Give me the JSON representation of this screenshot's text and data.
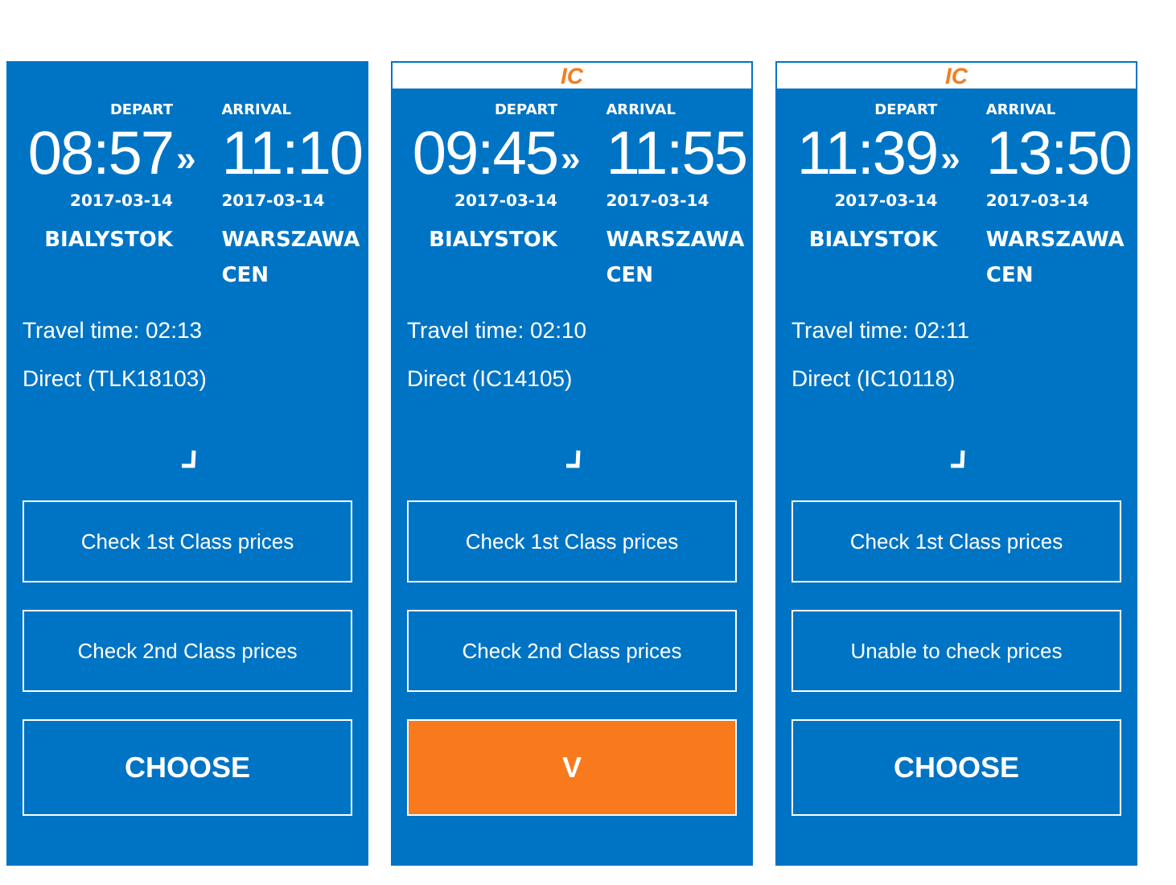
{
  "connections": [
    {
      "depart_label": "DEPART",
      "arrival_label": "ARRIVAL",
      "depart_time": "08:57",
      "separator": "»",
      "arrival_time": "11:10",
      "depart_date": "2017-03-14",
      "arrival_date": "2017-03-14",
      "from": "BIALYSTOK",
      "to": "WARSZAWA CEN",
      "travel_time": "Travel time: 02:13",
      "route": "Direct (TLK18103)",
      "buttons": [
        "Check 1st Class prices",
        "Check 2nd Class prices"
      ],
      "choose": {
        "label": "CHOOSE",
        "selected": false
      }
    },
    {
      "carrier_logo": "IC",
      "depart_label": "DEPART",
      "arrival_label": "ARRIVAL",
      "depart_time": "09:45",
      "separator": "»",
      "arrival_time": "11:55",
      "depart_date": "2017-03-14",
      "arrival_date": "2017-03-14",
      "from": "BIALYSTOK",
      "to": "WARSZAWA CEN",
      "travel_time": "Travel time: 02:10",
      "route": "Direct (IC14105)",
      "buttons": [
        "Check 1st Class prices",
        "Check 2nd Class prices"
      ],
      "choose": {
        "label": "V",
        "selected": true
      }
    },
    {
      "carrier_logo": "IC",
      "depart_label": "DEPART",
      "arrival_label": "ARRIVAL",
      "depart_time": "11:39",
      "separator": "»",
      "arrival_time": "13:50",
      "depart_date": "2017-03-14",
      "arrival_date": "2017-03-14",
      "from": "BIALYSTOK",
      "to": "WARSZAWA CEN",
      "travel_time": "Travel time: 02:11",
      "route": "Direct (IC10118)",
      "buttons": [
        "Check 1st Class prices",
        "Unable to check prices"
      ],
      "choose": {
        "label": "CHOOSE",
        "selected": false
      }
    }
  ]
}
